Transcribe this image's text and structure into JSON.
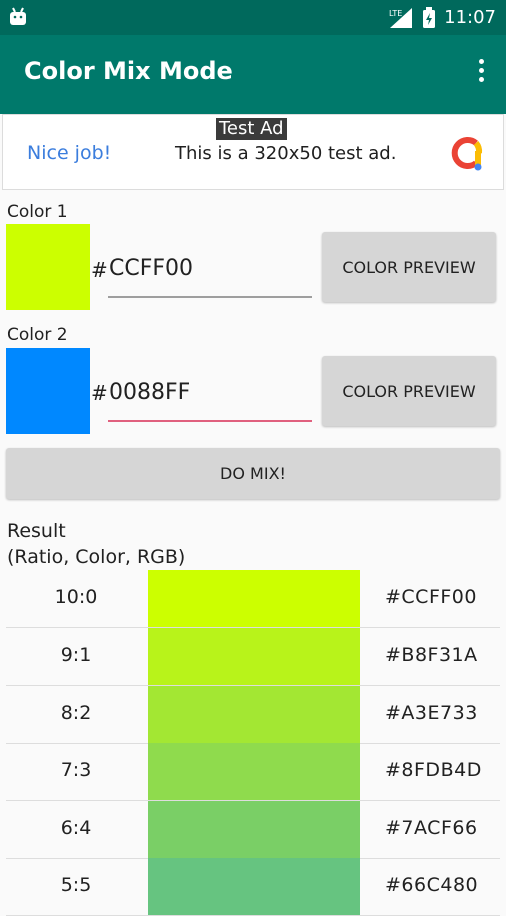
{
  "status_bar": {
    "time": "11:07",
    "network": "LTE"
  },
  "app_bar": {
    "title": "Color Mix Mode"
  },
  "ad": {
    "label": "Test Ad",
    "nice_text": "Nice job!",
    "body_text": "This is a 320x50 test ad."
  },
  "color1": {
    "label": "Color 1",
    "hash": "#",
    "value": "CCFF00",
    "swatch_color": "#CCFF00",
    "underline_color": "#9e9e9e",
    "button_label": "COLOR PREVIEW"
  },
  "color2": {
    "label": "Color 2",
    "hash": "#",
    "value": "0088FF",
    "swatch_color": "#0088FF",
    "underline_color": "#e0607e",
    "button_label": "COLOR PREVIEW"
  },
  "mix_button": "DO MIX!",
  "result": {
    "title_line1": "Result",
    "title_line2": "(Ratio, Color, RGB)",
    "rows": [
      {
        "ratio": "10:0",
        "rgb": "#CCFF00",
        "color": "#CCFF00"
      },
      {
        "ratio": "9:1",
        "rgb": "#B8F31A",
        "color": "#B8F31A"
      },
      {
        "ratio": "8:2",
        "rgb": "#A3E733",
        "color": "#A3E733"
      },
      {
        "ratio": "7:3",
        "rgb": "#8FDB4D",
        "color": "#8FDB4D"
      },
      {
        "ratio": "6:4",
        "rgb": "#7ACF66",
        "color": "#7ACF66"
      },
      {
        "ratio": "5:5",
        "rgb": "#66C480",
        "color": "#66C480"
      }
    ]
  },
  "theme": {
    "status_bar": "#00695c",
    "app_bar": "#00796b"
  }
}
